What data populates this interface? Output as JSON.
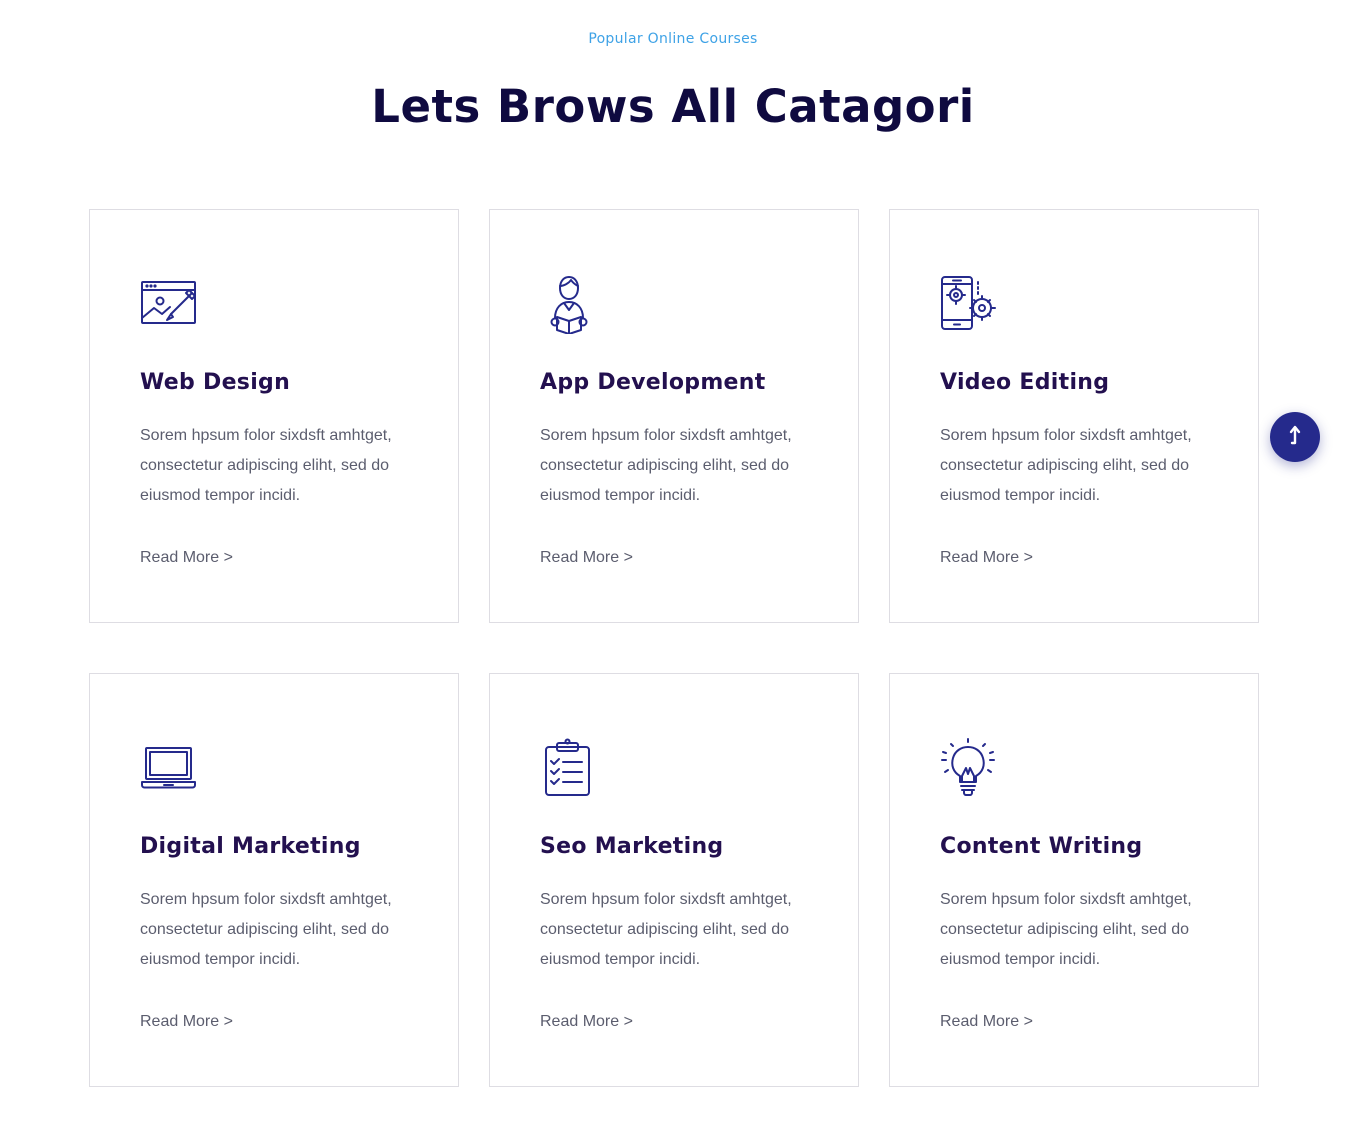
{
  "section": {
    "subtitle": "Popular Online Courses",
    "title": "Lets Brows All Catagori"
  },
  "colors": {
    "accent": "#3ea2e6",
    "heading": "#0f0a40",
    "card_title": "#23104f",
    "icon_stroke": "#252a8c",
    "body_text": "#5b5d6e",
    "card_border": "#dedde3"
  },
  "cards": [
    {
      "icon": "web-design-icon",
      "title": "Web Design",
      "text": "Sorem hpsum folor sixdsft amhtget, consectetur adipiscing eliht, sed do eiusmod tempor incidi.",
      "link": "Read More >"
    },
    {
      "icon": "app-development-icon",
      "title": "App Development",
      "text": "Sorem hpsum folor sixdsft amhtget, consectetur adipiscing eliht, sed do eiusmod tempor incidi.",
      "link": "Read More >"
    },
    {
      "icon": "video-editing-icon",
      "title": "Video Editing",
      "text": "Sorem hpsum folor sixdsft amhtget, consectetur adipiscing eliht, sed do eiusmod tempor incidi.",
      "link": "Read More >"
    },
    {
      "icon": "laptop-icon",
      "title": "Digital Marketing",
      "text": "Sorem hpsum folor sixdsft amhtget, consectetur adipiscing eliht, sed do eiusmod tempor incidi.",
      "link": "Read More >"
    },
    {
      "icon": "clipboard-checklist-icon",
      "title": "Seo Marketing",
      "text": "Sorem hpsum folor sixdsft amhtget, consectetur adipiscing eliht, sed do eiusmod tempor incidi.",
      "link": "Read More >"
    },
    {
      "icon": "lightbulb-icon",
      "title": "Content Writing",
      "text": "Sorem hpsum folor sixdsft amhtget, consectetur adipiscing eliht, sed do eiusmod tempor incidi.",
      "link": "Read More >"
    }
  ],
  "scroll_top": {
    "icon": "arrow-up-icon"
  }
}
